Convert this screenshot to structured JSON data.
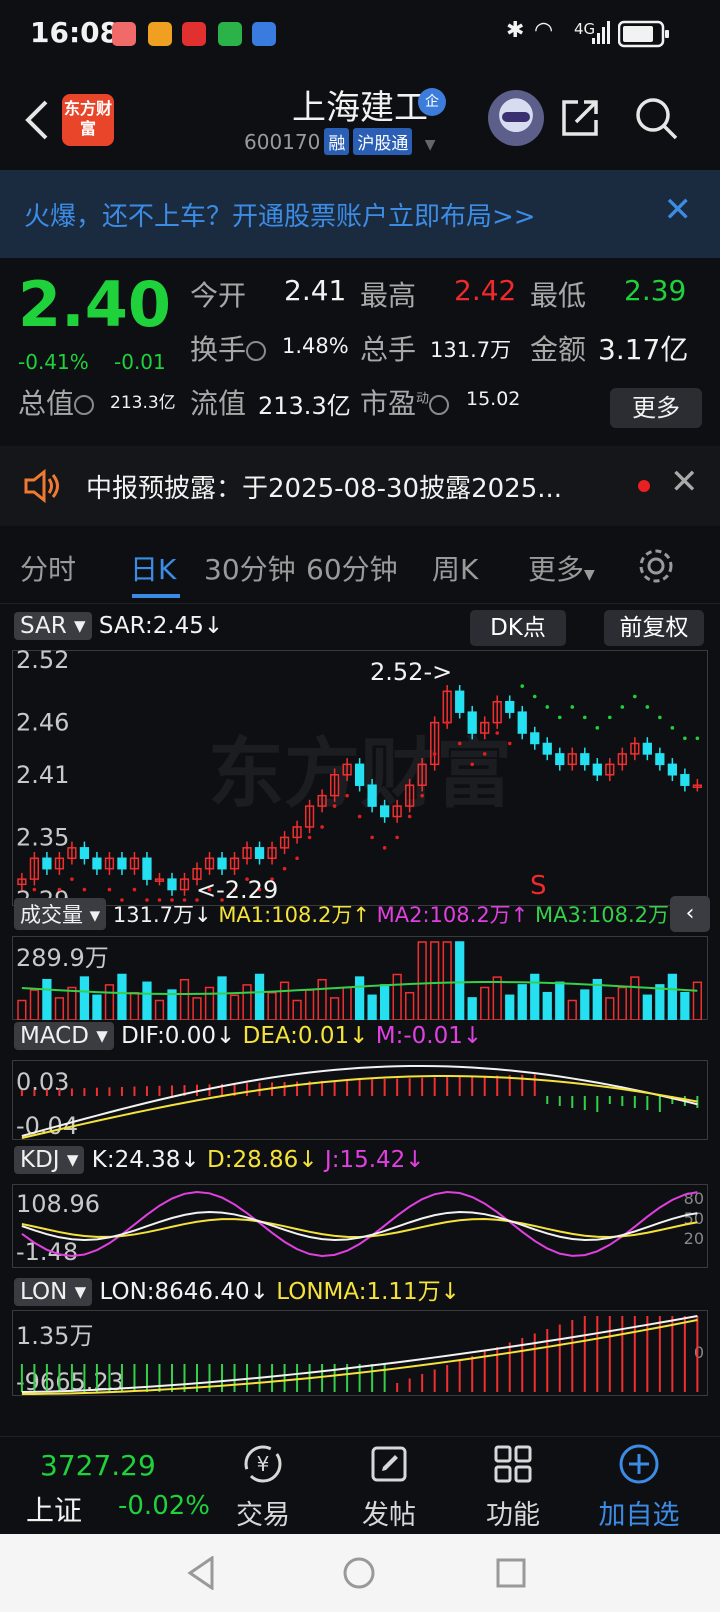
{
  "status_bar": {
    "time": "16:08",
    "network": "4G"
  },
  "header": {
    "logo_text": "东方财富",
    "stock_name": "上海建工",
    "badge": "企",
    "code": "600170",
    "tags": [
      "融",
      "沪股通"
    ]
  },
  "banner": {
    "text": "火爆，还不上车？开通股票账户立即布局>>"
  },
  "quote": {
    "price": "2.40",
    "change_pct": "-0.41%",
    "change": "-0.01",
    "open_label": "今开",
    "open": "2.41",
    "high_label": "最高",
    "high": "2.42",
    "low_label": "最低",
    "low": "2.39",
    "turnover_label": "换手",
    "turnover": "1.48%",
    "volume_label": "总手",
    "volume": "131.7万",
    "amount_label": "金额",
    "amount": "3.17亿",
    "mcap_label": "总值",
    "mcap": "213.3亿",
    "float_label": "流值",
    "float": "213.3亿",
    "pe_label": "市盈",
    "pe_sup": "动",
    "pe": "15.02",
    "more_label": "更多"
  },
  "notice": {
    "text": "中报预披露：于2025-08-30披露2025..."
  },
  "tabs": [
    "分时",
    "日K",
    "30分钟",
    "60分钟",
    "周K",
    "更多"
  ],
  "active_tab": "日K",
  "main_chart": {
    "indicator": "SAR",
    "value_text": "SAR:2.45↓",
    "dk_label": "DK点",
    "adjust_label": "前复权",
    "y_ticks": [
      "2.52",
      "2.46",
      "2.41",
      "2.35",
      "2.29"
    ],
    "high_note": "2.52->",
    "low_note": "<-2.29",
    "signal": "S",
    "watermark": "东方财富",
    "colors": {
      "up": "#f03030",
      "down": "#25e0f0",
      "sar_up": "#e02020",
      "sar_down": "#1fd23b"
    }
  },
  "volume_chart": {
    "indicator": "成交量",
    "value_text": "131.7万↓",
    "ma1": "MA1:108.2万↑",
    "ma2": "MA2:108.2万↑",
    "ma3": "MA3:108.2万↑",
    "y_tick": "289.9万"
  },
  "macd_chart": {
    "indicator": "MACD",
    "dif": "DIF:0.00↓",
    "dea": "DEA:0.01↓",
    "m": "M:-0.01↓",
    "y_ticks": [
      "0.03",
      "-0.04"
    ]
  },
  "kdj_chart": {
    "indicator": "KDJ",
    "k": "K:24.38↓",
    "d": "D:28.86↓",
    "j": "J:15.42↓",
    "y_ticks": [
      "108.96",
      "-1.48"
    ],
    "right_ticks": [
      "80",
      "50",
      "20"
    ]
  },
  "lon_chart": {
    "indicator": "LON",
    "lon": "LON:8646.40↓",
    "lonma": "LONMA:1.11万↓",
    "y_ticks": [
      "1.35万",
      "-9665.23"
    ],
    "right_tick": "0"
  },
  "chart_data": {
    "type": "candlestick",
    "note": "Daily K-line closes approximated from y-axis ticks",
    "ylim": [
      2.29,
      2.52
    ],
    "close": [
      2.31,
      2.33,
      2.32,
      2.33,
      2.34,
      2.33,
      2.32,
      2.33,
      2.32,
      2.33,
      2.31,
      2.31,
      2.3,
      2.31,
      2.32,
      2.33,
      2.32,
      2.33,
      2.34,
      2.33,
      2.34,
      2.35,
      2.36,
      2.38,
      2.39,
      2.41,
      2.42,
      2.4,
      2.38,
      2.37,
      2.38,
      2.4,
      2.42,
      2.46,
      2.49,
      2.47,
      2.45,
      2.46,
      2.48,
      2.47,
      2.45,
      2.44,
      2.43,
      2.42,
      2.43,
      2.42,
      2.41,
      2.42,
      2.43,
      2.44,
      2.43,
      2.42,
      2.41,
      2.4,
      2.4
    ],
    "volume_high_tick": "289.9万"
  },
  "bottom_bar": {
    "index_value": "3727.29",
    "index_name": "上证",
    "index_change": "-0.02%",
    "items": [
      "交易",
      "发帖",
      "功能",
      "加自选"
    ]
  }
}
